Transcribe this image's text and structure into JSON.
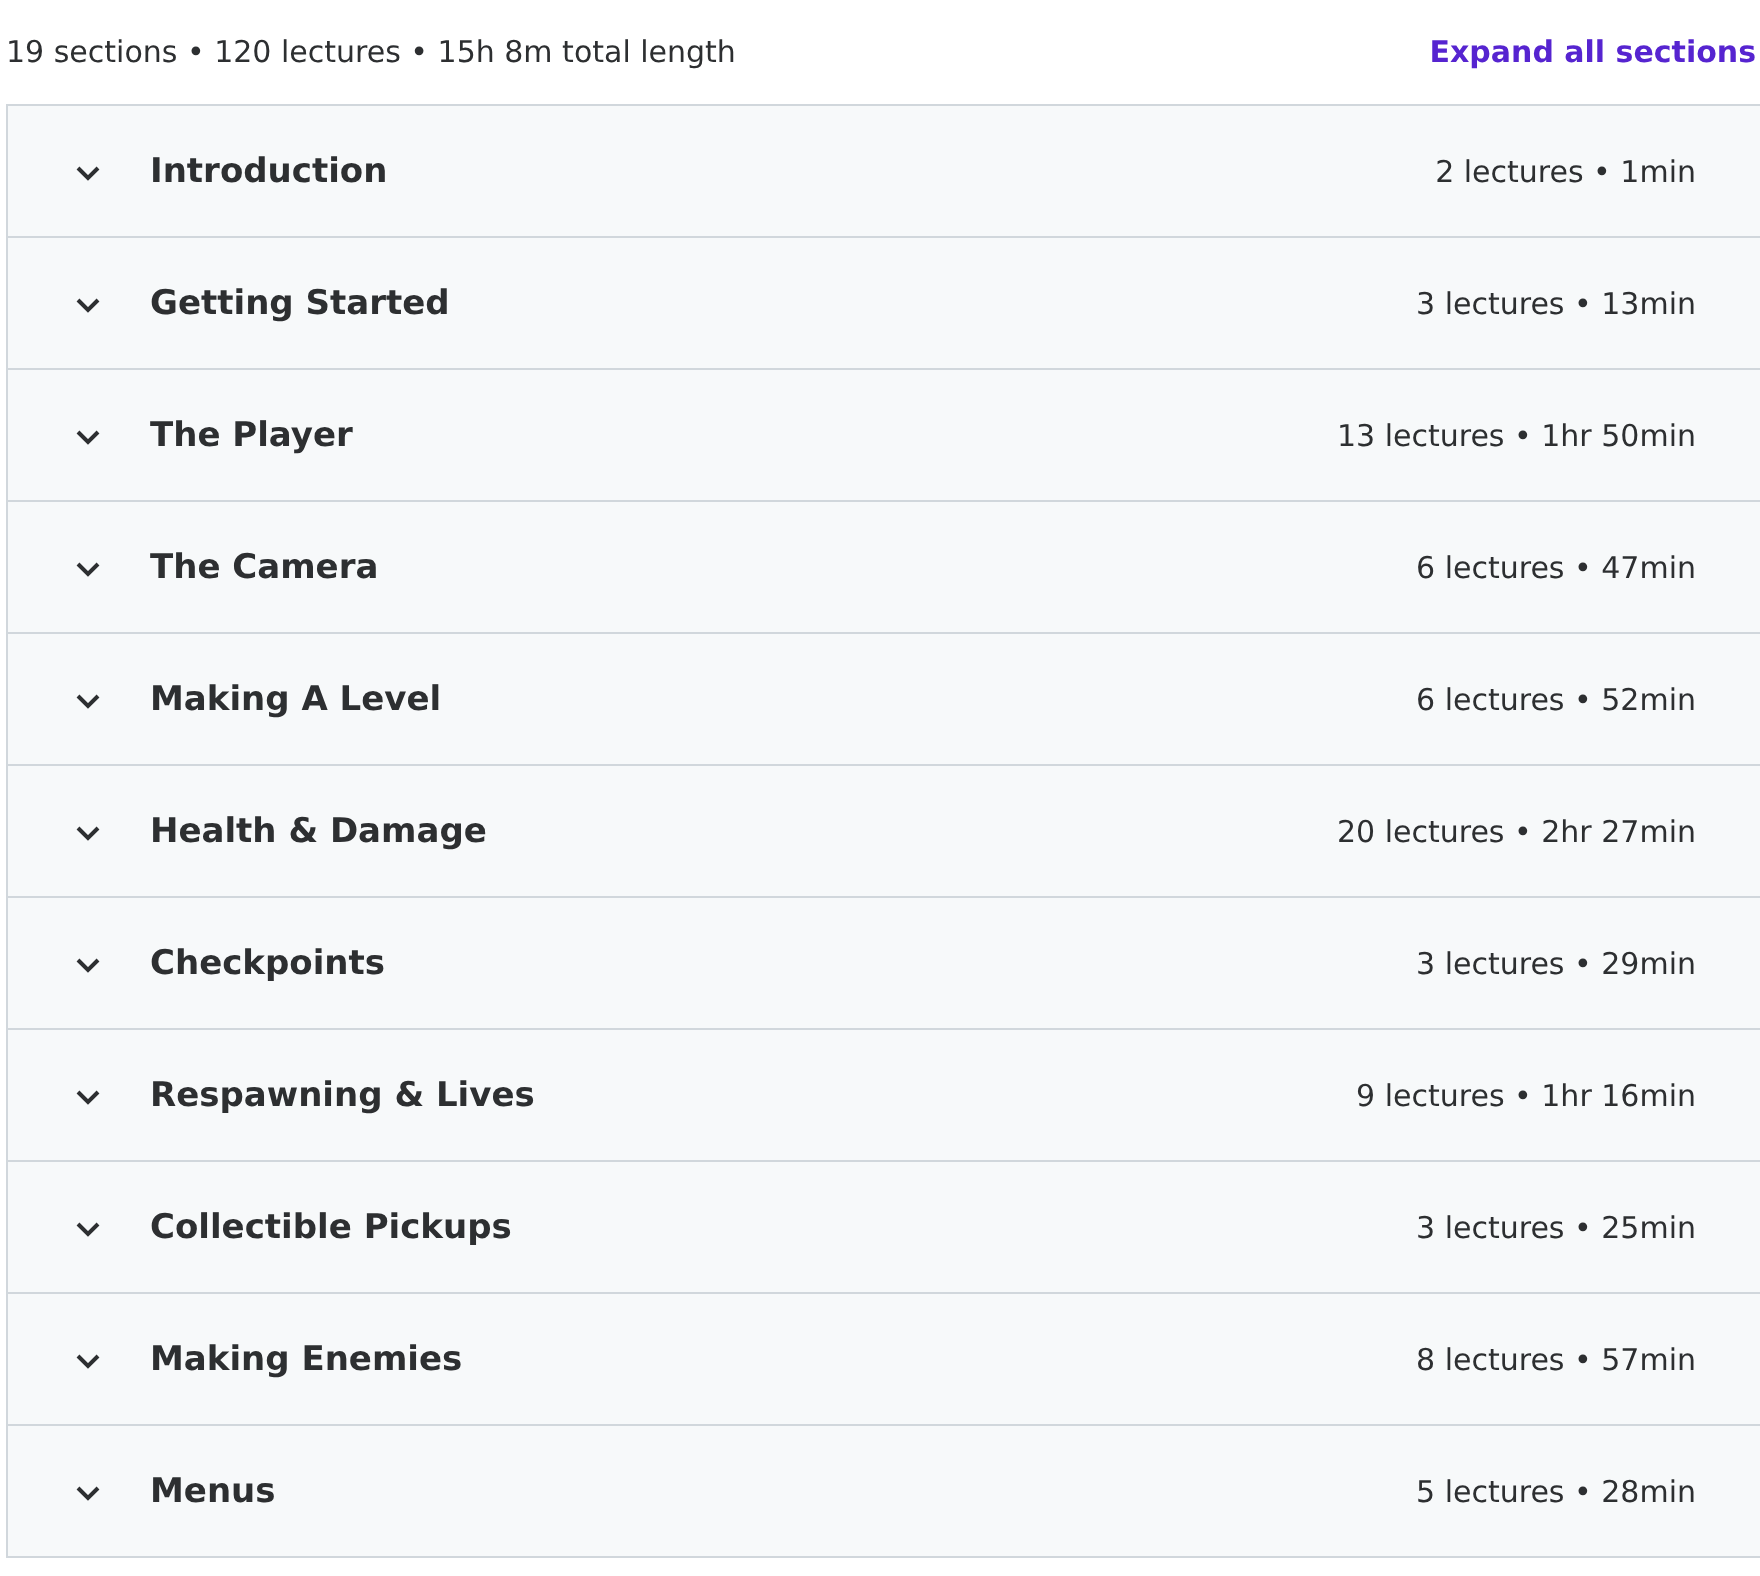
{
  "summary": "19 sections • 120 lectures • 15h 8m total length",
  "expand_link": "Expand all sections",
  "sections": [
    {
      "title": "Introduction",
      "meta": "2 lectures • 1min",
      "expanded": false
    },
    {
      "title": "Getting Started",
      "meta": "3 lectures • 13min",
      "expanded": false
    },
    {
      "title": "The Player",
      "meta": "13 lectures • 1hr 50min",
      "expanded": false
    },
    {
      "title": "The Camera",
      "meta": "6 lectures • 47min",
      "expanded": false
    },
    {
      "title": "Making A Level",
      "meta": "6 lectures • 52min",
      "expanded": false
    },
    {
      "title": "Health & Damage",
      "meta": "20 lectures • 2hr 27min",
      "expanded": false
    },
    {
      "title": "Checkpoints",
      "meta": "3 lectures • 29min",
      "expanded": false
    },
    {
      "title": "Respawning & Lives",
      "meta": "9 lectures • 1hr 16min",
      "expanded": false
    },
    {
      "title": "Collectible Pickups",
      "meta": "3 lectures • 25min",
      "expanded": false
    },
    {
      "title": "Making Enemies",
      "meta": "8 lectures • 57min",
      "expanded": false
    },
    {
      "title": "Menus",
      "meta": "5 lectures • 28min",
      "expanded": false
    }
  ]
}
